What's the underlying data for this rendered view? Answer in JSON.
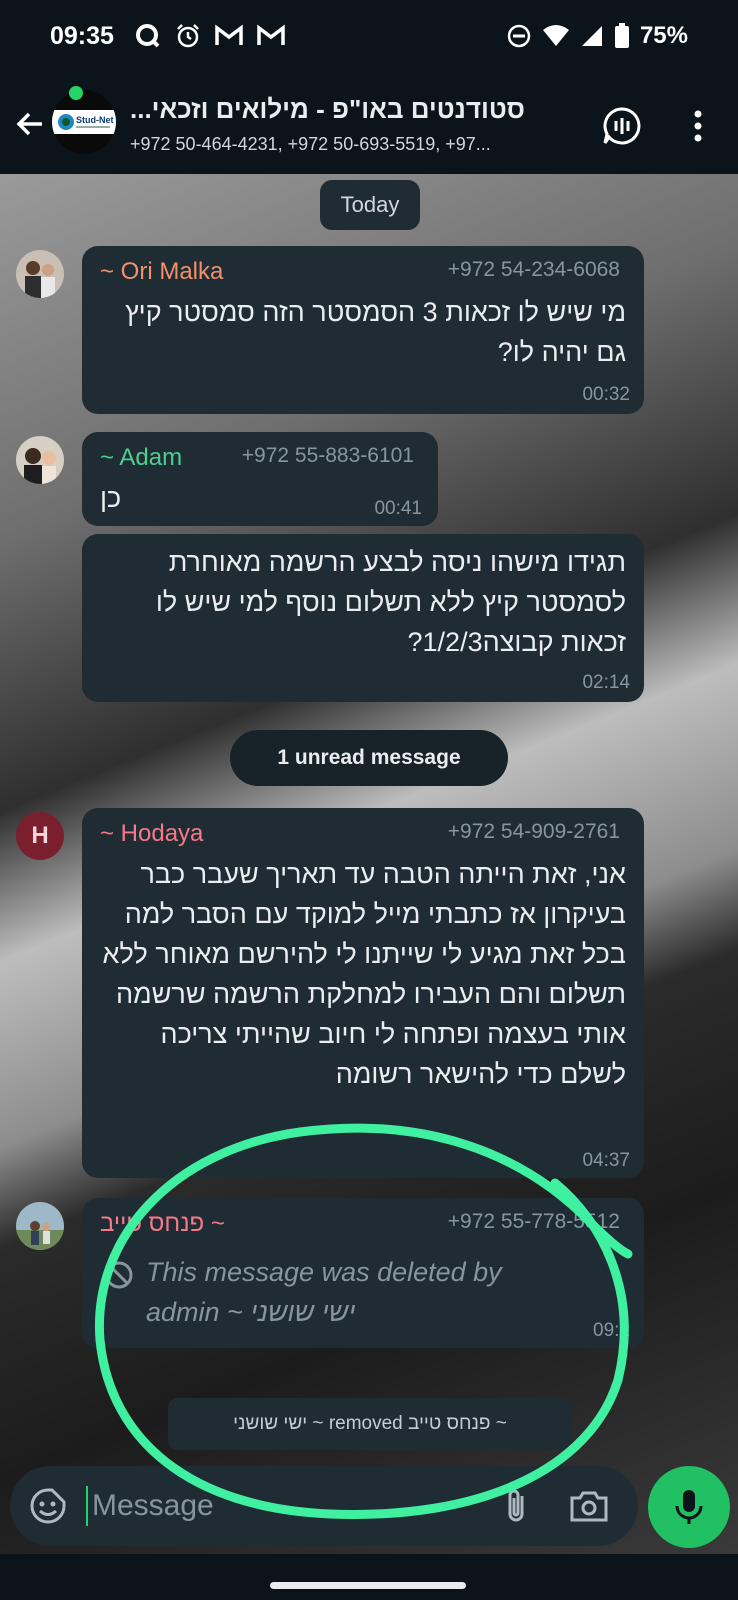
{
  "status_bar": {
    "time": "09:35",
    "battery": "75%",
    "icons_left": [
      "q-icon",
      "alarm-icon",
      "gmail-icon",
      "gmail-icon"
    ],
    "icons_right": [
      "dnd-icon",
      "wifi-icon",
      "signal-icon",
      "battery-icon"
    ]
  },
  "header": {
    "title": "סטודנטים באו\"פ - מילואים וזכאי...",
    "members": "+972 50-464-4231, +972 50-693-5519, +97...",
    "avatar_text": "Stud-Net"
  },
  "chat": {
    "date_label": "Today",
    "unread_label": "1 unread message",
    "messages": [
      {
        "sender": "~ Ori Malka",
        "phone": "+972 54-234-6068",
        "text": "מי שיש לו זכאות 3 הסמסטר הזה סמסטר קיץ גם יהיה לו?",
        "time": "00:32",
        "name_color": "#f3906c"
      },
      {
        "sender": "~ Adam",
        "phone": "+972 55-883-6101",
        "text": "כן",
        "time": "00:41",
        "name_color": "#4bd08f"
      },
      {
        "text": "תגידו מישהו ניסה לבצע הרשמה מאוחרת לסמסטר קיץ ללא תשלום נוסף למי שיש לו זכאות קבוצה1/2/3?",
        "time": "02:14"
      },
      {
        "sender": "~ Hodaya",
        "phone": "+972 54-909-2761",
        "avatar_letter": "H",
        "text": "אני, זאת הייתה הטבה עד תאריך שעבר כבר בעיקרון אז כתבתי מייל למוקד עם הסבר למה בכל זאת מגיע לי שייתנו לי להירשם מאוחר ללא תשלום והם העבירו למחלקת הרשמה שרשמה אותי בעצמה ופתחה לי חיוב שהייתי צריכה לשלם כדי להישאר רשומה",
        "time": "04:37",
        "name_color": "#f77987"
      },
      {
        "sender": "~ פנחס טייב",
        "phone": "+972 55-778-5512",
        "deleted_text": "This message was deleted by admin  ~ ישי שושני",
        "time": "09:2",
        "name_color": "#f77987"
      }
    ],
    "system_message": "~ פנחס טייב removed ~ ישי שושני"
  },
  "compose": {
    "placeholder": "Message"
  },
  "colors": {
    "accent": "#25d366",
    "annotation": "#3ef0a0",
    "bubble": "#202c33",
    "background": "#0b141a"
  }
}
